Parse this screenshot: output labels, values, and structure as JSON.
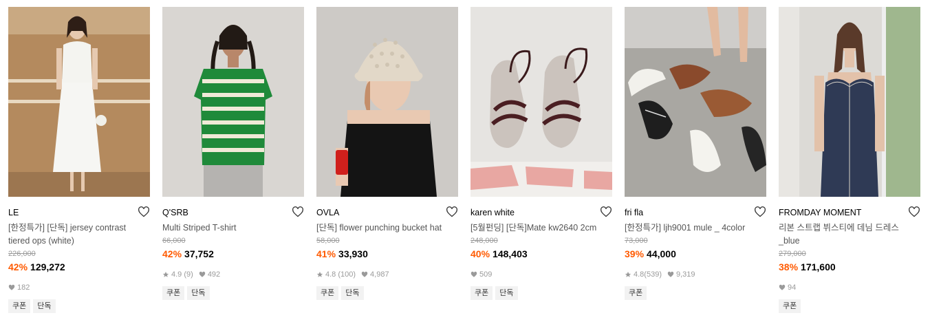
{
  "colors": {
    "discount": "#ff5a00",
    "muted": "#9a9a9a",
    "tag_bg": "#f2f2f2"
  },
  "products": [
    {
      "brand": "LE",
      "title": "[한정특가] [단독] jersey contrast tiered ops (white)",
      "original_price": "226,000",
      "discount": "42%",
      "price": "129,272",
      "likes": "182",
      "tags": [
        "쿠폰",
        "단독"
      ]
    },
    {
      "brand": "Q'SRB",
      "title": "Multi Striped T-shirt",
      "original_price": "66,000",
      "discount": "42%",
      "price": "37,752",
      "rating": "4.9",
      "reviews": "(9)",
      "likes": "492",
      "tags": [
        "쿠폰",
        "단독"
      ]
    },
    {
      "brand": "OVLA",
      "title": "[단독] flower punching bucket hat",
      "original_price": "58,000",
      "discount": "41%",
      "price": "33,930",
      "rating": "4.8",
      "reviews": "(100)",
      "likes": "4,987",
      "tags": [
        "쿠폰",
        "단독"
      ]
    },
    {
      "brand": "karen white",
      "title": "[5월펀딩] [단독]Mate kw2640 2cm",
      "original_price": "248,000",
      "discount": "40%",
      "price": "148,403",
      "likes": "509",
      "tags": [
        "쿠폰",
        "단독"
      ]
    },
    {
      "brand": "fri fla",
      "title": "[한정특가] ljh9001 mule _ 4color",
      "original_price": "73,000",
      "discount": "39%",
      "price": "44,000",
      "rating": "4.8",
      "reviews": "(539)",
      "likes": "9,319",
      "tags": [
        "쿠폰"
      ]
    },
    {
      "brand": "FROMDAY MOMENT",
      "title": "리본 스트랩 뷔스티에 데님 드레스 _blue",
      "original_price": "279,000",
      "discount": "38%",
      "price": "171,600",
      "likes": "94",
      "tags": [
        "쿠폰"
      ]
    }
  ],
  "icons": {
    "wishlist": "heart-outline-icon",
    "rating": "star-icon",
    "likes": "heart-filled-icon"
  }
}
